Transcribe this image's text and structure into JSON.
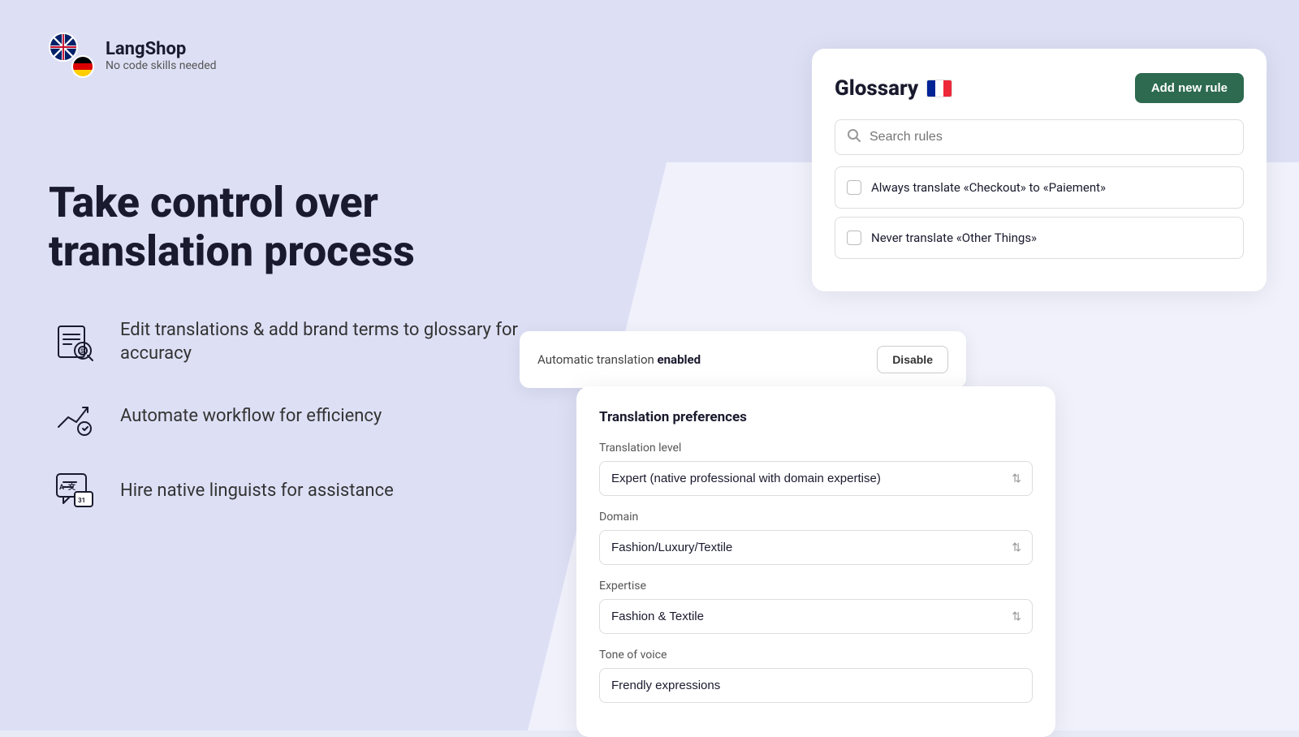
{
  "app": {
    "title": "LangShop",
    "subtitle": "No code skills needed"
  },
  "hero": {
    "heading_line1": "Take control over",
    "heading_line2": "translation process"
  },
  "features": [
    {
      "id": "glossary",
      "text": "Edit translations & add brand terms to glossary for accuracy"
    },
    {
      "id": "workflow",
      "text": "Automate workflow for efficiency"
    },
    {
      "id": "linguists",
      "text": "Hire native linguists for assistance"
    }
  ],
  "glossary": {
    "title": "Glossary",
    "add_button": "Add new rule",
    "search_placeholder": "Search rules",
    "rules": [
      {
        "id": "rule1",
        "text": "Always translate «Checkout» to «Paiement»",
        "checked": false
      },
      {
        "id": "rule2",
        "text": "Never translate «Other Things»",
        "checked": false
      }
    ]
  },
  "auto_translate": {
    "label": "Automatic translation",
    "status": "enabled",
    "disable_button": "Disable"
  },
  "translation_prefs": {
    "title": "Translation preferences",
    "translation_level_label": "Translation level",
    "translation_level_value": "Expert (native professional with domain expertise)",
    "domain_label": "Domain",
    "domain_value": "Fashion/Luxury/Textile",
    "expertise_label": "Expertise",
    "expertise_value": "Fashion & Textile",
    "tone_label": "Tone of voice",
    "tone_value": "Frendly expressions"
  },
  "colors": {
    "add_button_bg": "#2d6a4f",
    "background": "#dde0f5"
  }
}
